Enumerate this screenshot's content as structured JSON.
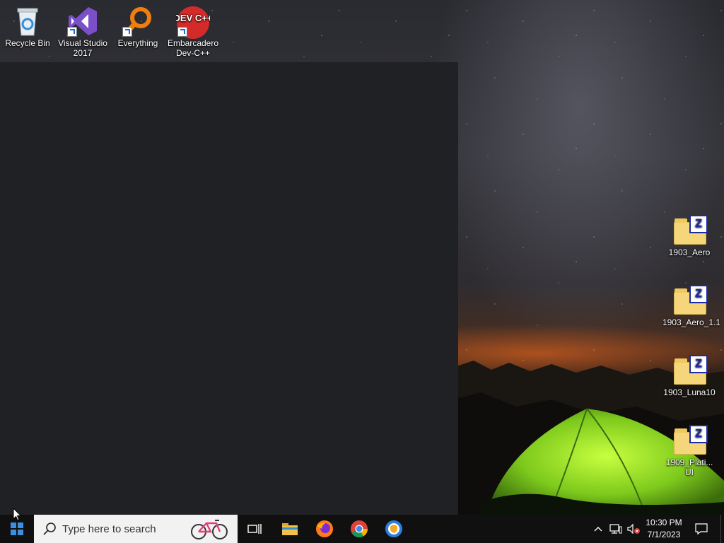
{
  "desktop_icons_top": [
    {
      "name": "recycle-bin-icon",
      "label": "Recycle Bin"
    },
    {
      "name": "visual-studio-icon",
      "label": "Visual Studio 2017"
    },
    {
      "name": "everything-icon",
      "label": "Everything"
    },
    {
      "name": "devcpp-icon",
      "label": "Embarcadero Dev-C++",
      "logo_text": "DEV C++"
    }
  ],
  "desktop_icons_right": [
    {
      "label": "1903_Aero"
    },
    {
      "label": "1903_Aero_1.1"
    },
    {
      "label": "1903_Luna10"
    },
    {
      "label": "1909_Plati... UI"
    }
  ],
  "taskbar": {
    "search_placeholder": "Type here to search",
    "pinned": [
      "task-view-icon",
      "file-explorer-icon",
      "firefox-icon",
      "chrome-icon",
      "privacy-browser-icon"
    ],
    "clock_time": "10:30 PM",
    "clock_date": "7/1/2023"
  },
  "colors": {
    "taskbar": "#101010",
    "panel": "#202124",
    "search_bg": "#f2f2f2"
  }
}
